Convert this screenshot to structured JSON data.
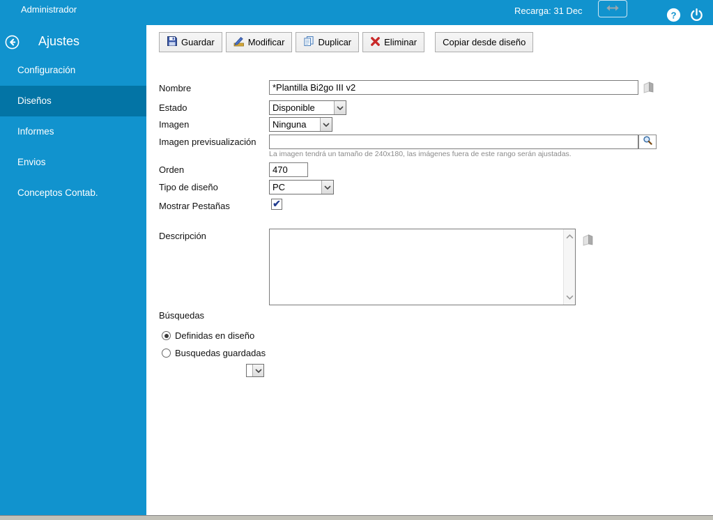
{
  "topbar": {
    "user": "Administrador",
    "reload_text": "Recarga: 31 Dec"
  },
  "sidebar": {
    "title": "Ajustes",
    "items": [
      {
        "label": "Configuración",
        "selected": false
      },
      {
        "label": "Diseños",
        "selected": true
      },
      {
        "label": "Informes",
        "selected": false
      },
      {
        "label": "Envios",
        "selected": false
      },
      {
        "label": "Conceptos Contab.",
        "selected": false
      }
    ]
  },
  "toolbar": {
    "buttons": [
      {
        "label": "Guardar",
        "icon": "save-icon"
      },
      {
        "label": "Modificar",
        "icon": "edit-icon"
      },
      {
        "label": "Duplicar",
        "icon": "copy-icon"
      },
      {
        "label": "Eliminar",
        "icon": "delete-icon"
      },
      {
        "label": "Copiar desde diseño",
        "icon": ""
      }
    ]
  },
  "form": {
    "nombre_label": "Nombre",
    "nombre_value": "*Plantilla Bi2go III v2",
    "estado_label": "Estado",
    "estado_value": "Disponible",
    "imagen_label": "Imagen",
    "imagen_value": "Ninguna",
    "imagen_prev_label": "Imagen previsualización",
    "imagen_prev_value": "",
    "imagen_help": "La imagen tendrá un tamaño de 240x180, las imágenes fuera de este rango serán ajustadas.",
    "orden_label": "Orden",
    "orden_value": "470",
    "tipo_label": "Tipo de diseño",
    "tipo_value": "PC",
    "pestanas_label": "Mostrar Pestañas",
    "pestanas_checked": true,
    "descripcion_label": "Descripción",
    "descripcion_value": "",
    "busquedas_label": "Búsquedas",
    "busquedas_options": [
      {
        "label": "Definidas en diseño",
        "selected": true
      },
      {
        "label": "Busquedas guardadas",
        "selected": false
      }
    ]
  },
  "colors": {
    "brand_blue": "#1193ce",
    "sidebar_selected": "#0374a5",
    "delete_red": "#c92a2a"
  }
}
